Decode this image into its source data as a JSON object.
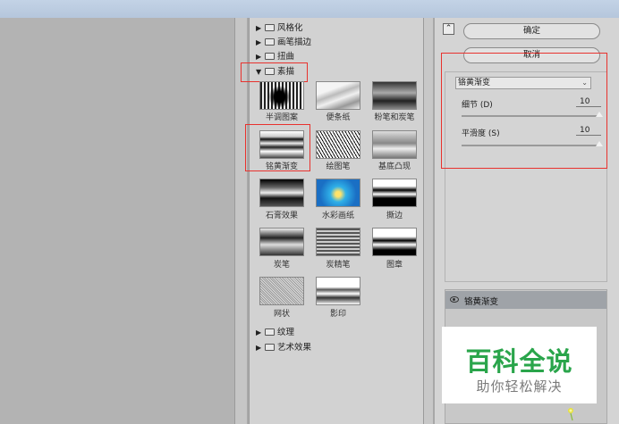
{
  "gallery": {
    "folders_top": [
      {
        "label": "风格化",
        "expanded": false
      },
      {
        "label": "画笔描边",
        "expanded": false
      },
      {
        "label": "扭曲",
        "expanded": false
      },
      {
        "label": "素描",
        "expanded": true
      }
    ],
    "sketch_filters": [
      {
        "label": "半调图案",
        "icon": "halftone-thumb",
        "selected": false
      },
      {
        "label": "便条纸",
        "icon": "note-paper-thumb",
        "selected": false
      },
      {
        "label": "粉笔和炭笔",
        "icon": "chalk-charcoal-thumb",
        "selected": false
      },
      {
        "label": "铭黄渐变",
        "icon": "chrome-thumb",
        "selected": true
      },
      {
        "label": "绘图笔",
        "icon": "graphic-pen-thumb",
        "selected": false
      },
      {
        "label": "基底凸现",
        "icon": "bas-relief-thumb",
        "selected": false
      },
      {
        "label": "石膏效果",
        "icon": "plaster-thumb",
        "selected": false
      },
      {
        "label": "水彩画纸",
        "icon": "water-paper-thumb",
        "selected": false
      },
      {
        "label": "撕边",
        "icon": "torn-edges-thumb",
        "selected": false
      },
      {
        "label": "炭笔",
        "icon": "charcoal-thumb",
        "selected": false
      },
      {
        "label": "炭精笔",
        "icon": "conte-crayon-thumb",
        "selected": false
      },
      {
        "label": "图章",
        "icon": "stamp-thumb",
        "selected": false
      },
      {
        "label": "网状",
        "icon": "reticulation-thumb",
        "selected": false
      },
      {
        "label": "影印",
        "icon": "photocopy-thumb",
        "selected": false
      }
    ],
    "folders_bottom": [
      {
        "label": "纹理",
        "expanded": false
      },
      {
        "label": "艺术效果",
        "expanded": false
      }
    ]
  },
  "buttons": {
    "ok": "确定",
    "cancel": "取消"
  },
  "settings": {
    "filter_selected": "铬黄渐变",
    "params": [
      {
        "label": "细节 (D)",
        "value": "10"
      },
      {
        "label": "平滑度 (S)",
        "value": "10"
      }
    ]
  },
  "layers": {
    "active_layer": "铬黄渐变"
  },
  "watermark": {
    "title": "百科全说",
    "subtitle": "助你轻松解决"
  },
  "colors": {
    "highlight_box": "#e8322e",
    "watermark_green": "#2aa54b"
  }
}
